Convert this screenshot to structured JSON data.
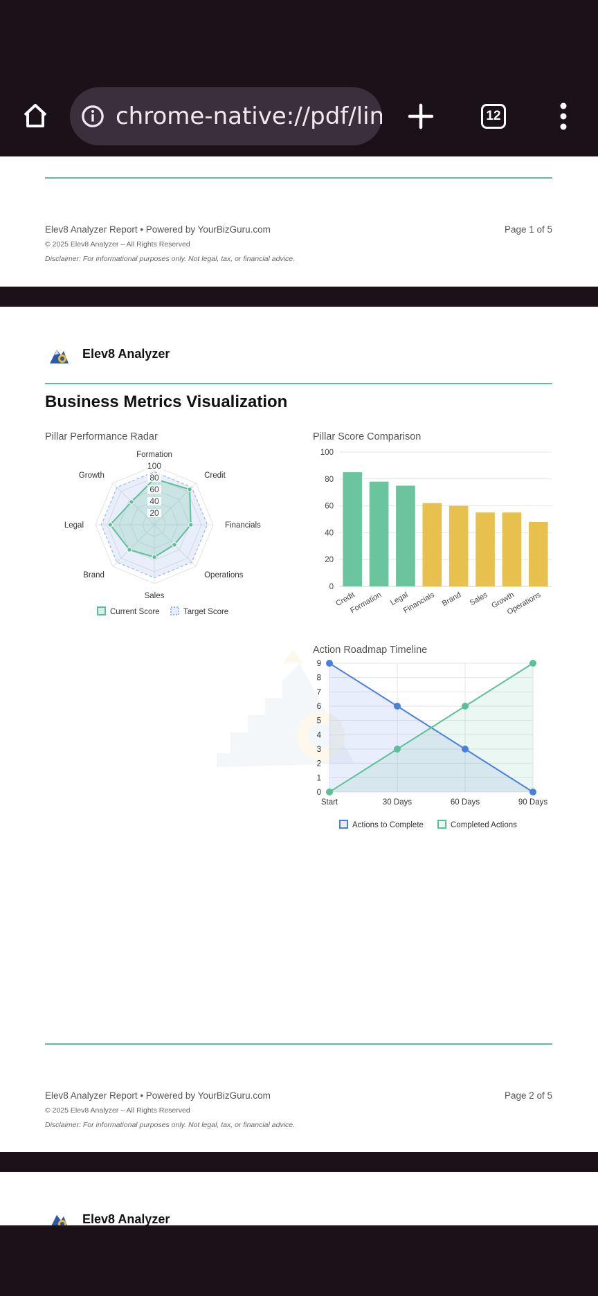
{
  "browser": {
    "url": "chrome-native://pdf/link",
    "tab_count": "12",
    "icons": [
      "home-icon",
      "info-icon",
      "new-tab-icon",
      "tab-switcher-icon",
      "menu-icon"
    ]
  },
  "page1_footer": {
    "left": "Elev8 Analyzer Report • Powered by YourBizGuru.com",
    "right": "Page 1 of 5",
    "copyright": "© 2025 Elev8 Analyzer – All Rights Reserved",
    "disclaimer": "Disclaimer: For informational purposes only. Not legal, tax, or financial advice."
  },
  "page2": {
    "brand": "Elev8 Analyzer",
    "heading": "Business Metrics Visualization",
    "radar_title": "Pillar Performance Radar",
    "bar_title": "Pillar Score Comparison",
    "timeline_title": "Action Roadmap Timeline",
    "footer": {
      "left": "Elev8 Analyzer Report • Powered by YourBizGuru.com",
      "right": "Page 2 of 5",
      "copyright": "© 2025 Elev8 Analyzer – All Rights Reserved",
      "disclaimer": "Disclaimer: For informational purposes only. Not legal, tax, or financial advice."
    }
  },
  "page3": {
    "brand": "Elev8 Analyzer"
  },
  "colors": {
    "green": "#5dbf97",
    "blue": "#4a7fe0",
    "gold": "#e8c04e",
    "dark": "#1b1118"
  },
  "chart_data": [
    {
      "type": "radar",
      "title": "Pillar Performance Radar",
      "axes": [
        "Formation",
        "Credit",
        "Financials",
        "Operations",
        "Sales",
        "Brand",
        "Legal",
        "Growth"
      ],
      "ticks": [
        20,
        40,
        60,
        80,
        100
      ],
      "tick_labels": [
        "20",
        "40",
        "60",
        "80",
        "100"
      ],
      "rmax": 100,
      "series": [
        {
          "name": "Current Score",
          "values": [
            78,
            85,
            62,
            48,
            55,
            60,
            75,
            55
          ],
          "color": "#5dbf97"
        },
        {
          "name": "Target Score",
          "values": [
            90,
            90,
            90,
            90,
            90,
            90,
            90,
            90
          ],
          "color": "#9bb4ea"
        }
      ],
      "legend": "bottom"
    },
    {
      "type": "bar",
      "title": "Pillar Score Comparison",
      "categories": [
        "Credit",
        "Formation",
        "Legal",
        "Financials",
        "Brand",
        "Sales",
        "Growth",
        "Operations"
      ],
      "values": [
        85,
        78,
        75,
        62,
        60,
        55,
        55,
        48
      ],
      "colors": [
        "#6cc49e",
        "#6cc49e",
        "#6cc49e",
        "#e8c04e",
        "#e8c04e",
        "#e8c04e",
        "#e8c04e",
        "#e8c04e"
      ],
      "ylim": [
        0,
        100
      ],
      "yticks": [
        0,
        20,
        40,
        60,
        80,
        100
      ],
      "grid": true
    },
    {
      "type": "area",
      "title": "Action Roadmap Timeline",
      "categories": [
        "Start",
        "30 Days",
        "60 Days",
        "90 Days"
      ],
      "series": [
        {
          "name": "Actions to Complete",
          "values": [
            9,
            6,
            3,
            0
          ],
          "color": "#4a7fe0"
        },
        {
          "name": "Completed Actions",
          "values": [
            0,
            3,
            6,
            9
          ],
          "color": "#5dbf97"
        }
      ],
      "ylim": [
        0,
        9
      ],
      "yticks": [
        0,
        1,
        2,
        3,
        4,
        5,
        6,
        7,
        8,
        9
      ],
      "grid": true,
      "legend": "bottom"
    }
  ]
}
